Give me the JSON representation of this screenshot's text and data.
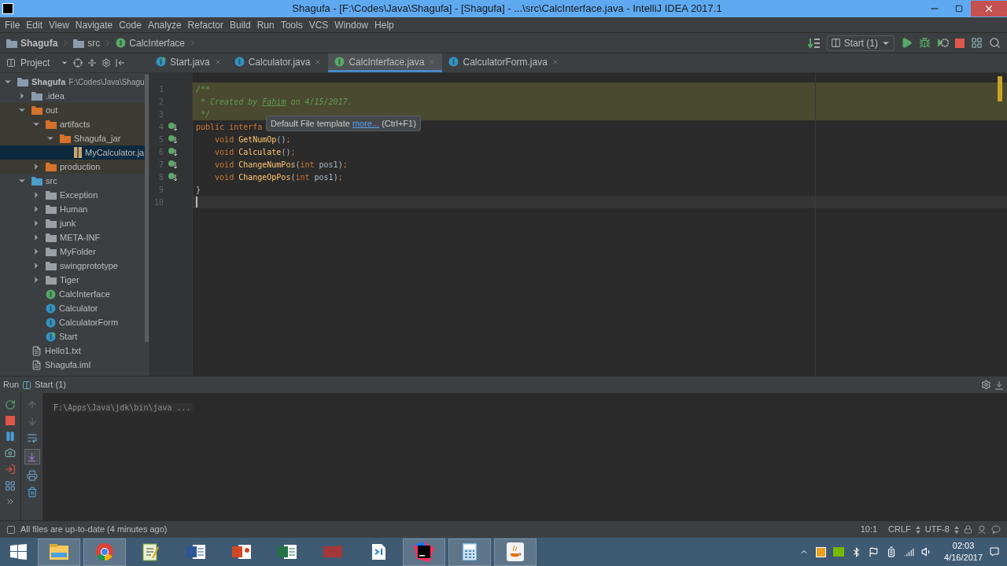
{
  "window": {
    "title": "Shagufa - [F:\\Codes\\Java\\Shagufa] - [Shagufa] - ...\\src\\CalcInterface.java - IntelliJ IDEA 2017.1"
  },
  "menu": [
    "File",
    "Edit",
    "View",
    "Navigate",
    "Code",
    "Analyze",
    "Refactor",
    "Build",
    "Run",
    "Tools",
    "VCS",
    "Window",
    "Help"
  ],
  "breadcrumbs": [
    {
      "kind": "module",
      "label": "Shagufa"
    },
    {
      "kind": "folder",
      "label": "src"
    },
    {
      "kind": "interface",
      "label": "CalcInterface"
    }
  ],
  "run_config": "Start (1)",
  "project_panel": {
    "title": "Project"
  },
  "tabs": [
    {
      "label": "Start.java",
      "kind": "runnable_class",
      "selected": false
    },
    {
      "label": "Calculator.java",
      "kind": "class",
      "selected": false
    },
    {
      "label": "CalcInterface.java",
      "kind": "interface",
      "selected": true
    },
    {
      "label": "CalculatorForm.java",
      "kind": "class",
      "selected": false
    }
  ],
  "tree": [
    {
      "label": "Shagufa",
      "path": "F:\\Codes\\Java\\Shagu",
      "kind": "module",
      "expanded": true,
      "selected": false,
      "children": [
        {
          "label": ".idea",
          "kind": "folder",
          "expanded": false,
          "selected": false
        },
        {
          "label": "out",
          "kind": "excluded_folder",
          "expanded": true,
          "selected": false,
          "children": [
            {
              "label": "artifacts",
              "kind": "excluded_folder",
              "expanded": true,
              "selected": false,
              "children": [
                {
                  "label": "Shagufa_jar",
                  "kind": "excluded_folder",
                  "expanded": true,
                  "selected": false,
                  "children": [
                    {
                      "label": "MyCalculator.ja",
                      "kind": "jar",
                      "selected": true
                    }
                  ]
                }
              ]
            },
            {
              "label": "production",
              "kind": "excluded_folder",
              "expanded": false,
              "selected": false
            }
          ]
        },
        {
          "label": "src",
          "kind": "source_folder",
          "expanded": true,
          "selected": false,
          "children": [
            {
              "label": "Exception",
              "kind": "package",
              "expanded": false,
              "selected": false
            },
            {
              "label": "Human",
              "kind": "package",
              "expanded": false,
              "selected": false
            },
            {
              "label": "junk",
              "kind": "package",
              "expanded": false,
              "selected": false
            },
            {
              "label": "META-INF",
              "kind": "package",
              "expanded": false,
              "selected": false
            },
            {
              "label": "MyFolder",
              "kind": "package",
              "expanded": false,
              "selected": false
            },
            {
              "label": "swingprototype",
              "kind": "package",
              "expanded": false,
              "selected": false
            },
            {
              "label": "Tiger",
              "kind": "package",
              "expanded": false,
              "selected": false
            },
            {
              "label": "CalcInterface",
              "kind": "interface",
              "selected": false
            },
            {
              "label": "Calculator",
              "kind": "class",
              "selected": false
            },
            {
              "label": "CalculatorForm",
              "kind": "class",
              "selected": false
            },
            {
              "label": "Start",
              "kind": "runnable_class",
              "selected": false
            }
          ]
        },
        {
          "label": "Hello1.txt",
          "kind": "file",
          "selected": false
        },
        {
          "label": "Shagufa.iml",
          "kind": "file",
          "selected": false
        }
      ]
    }
  ],
  "editor": {
    "lines": [
      {
        "number": "1",
        "highlighted": true,
        "current": false,
        "implemented": false,
        "tokens": [
          {
            "kind": "comment",
            "text": "/**"
          }
        ]
      },
      {
        "number": "2",
        "highlighted": true,
        "current": false,
        "implemented": false,
        "tokens": [
          {
            "kind": "comment",
            "text": " * Created by "
          },
          {
            "kind": "comment_name",
            "text": "Fahim"
          },
          {
            "kind": "comment",
            "text": " on 4/15/2017."
          }
        ]
      },
      {
        "number": "3",
        "highlighted": true,
        "current": false,
        "implemented": false,
        "tokens": [
          {
            "kind": "comment",
            "text": " */"
          }
        ]
      },
      {
        "number": "4",
        "highlighted": false,
        "current": false,
        "implemented": true,
        "tokens": [
          {
            "kind": "keyword",
            "text": "public interfa"
          }
        ]
      },
      {
        "number": "5",
        "highlighted": false,
        "current": false,
        "implemented": true,
        "tokens": [
          {
            "kind": "keyword",
            "text": "    void "
          },
          {
            "kind": "method",
            "text": "GetNumOp"
          },
          {
            "kind": "plain",
            "text": "()"
          },
          {
            "kind": "punct",
            "text": ";"
          }
        ]
      },
      {
        "number": "6",
        "highlighted": false,
        "current": false,
        "implemented": true,
        "tokens": [
          {
            "kind": "keyword",
            "text": "    void "
          },
          {
            "kind": "method",
            "text": "Calculate"
          },
          {
            "kind": "plain",
            "text": "()"
          },
          {
            "kind": "punct",
            "text": ";"
          }
        ]
      },
      {
        "number": "7",
        "highlighted": false,
        "current": false,
        "implemented": true,
        "tokens": [
          {
            "kind": "keyword",
            "text": "    void "
          },
          {
            "kind": "method",
            "text": "ChangeNumPos"
          },
          {
            "kind": "plain",
            "text": "("
          },
          {
            "kind": "keyword",
            "text": "int "
          },
          {
            "kind": "plain",
            "text": "pos1)"
          },
          {
            "kind": "punct",
            "text": ";"
          }
        ]
      },
      {
        "number": "8",
        "highlighted": false,
        "current": false,
        "implemented": true,
        "tokens": [
          {
            "kind": "keyword",
            "text": "    void "
          },
          {
            "kind": "method",
            "text": "ChangeOpPos"
          },
          {
            "kind": "plain",
            "text": "("
          },
          {
            "kind": "keyword",
            "text": "int "
          },
          {
            "kind": "plain",
            "text": "pos1)"
          },
          {
            "kind": "punct",
            "text": ";"
          }
        ]
      },
      {
        "number": "9",
        "highlighted": false,
        "current": false,
        "implemented": false,
        "tokens": [
          {
            "kind": "plain",
            "text": "}"
          }
        ]
      },
      {
        "number": "10",
        "highlighted": false,
        "current": true,
        "implemented": false
      }
    ],
    "tooltip": {
      "text": "Default File template",
      "link": "more...",
      "shortcut": "(Ctrl+F1)"
    }
  },
  "run_panel": {
    "label": "Run",
    "config": "Start (1)",
    "output": "F:\\Apps\\Java\\jdk\\bin\\java ..."
  },
  "status_bar": {
    "message": "All files are up-to-date (4 minutes ago)",
    "position": "10:1",
    "line_separator": "CRLF",
    "encoding": "UTF-8"
  },
  "taskbar": {
    "apps": [
      {
        "kind": "explorer",
        "running": true
      },
      {
        "kind": "chrome",
        "running": true
      },
      {
        "kind": "notepad",
        "running": false
      },
      {
        "kind": "word",
        "running": false
      },
      {
        "kind": "powerpoint",
        "running": false
      },
      {
        "kind": "excel",
        "running": false
      },
      {
        "kind": "access",
        "running": false
      },
      {
        "kind": "vscode",
        "running": false
      },
      {
        "kind": "intellij",
        "running": true
      },
      {
        "kind": "calculator",
        "running": true
      },
      {
        "kind": "java",
        "running": true
      }
    ],
    "time": "02:03",
    "date": "4/16/2017"
  }
}
